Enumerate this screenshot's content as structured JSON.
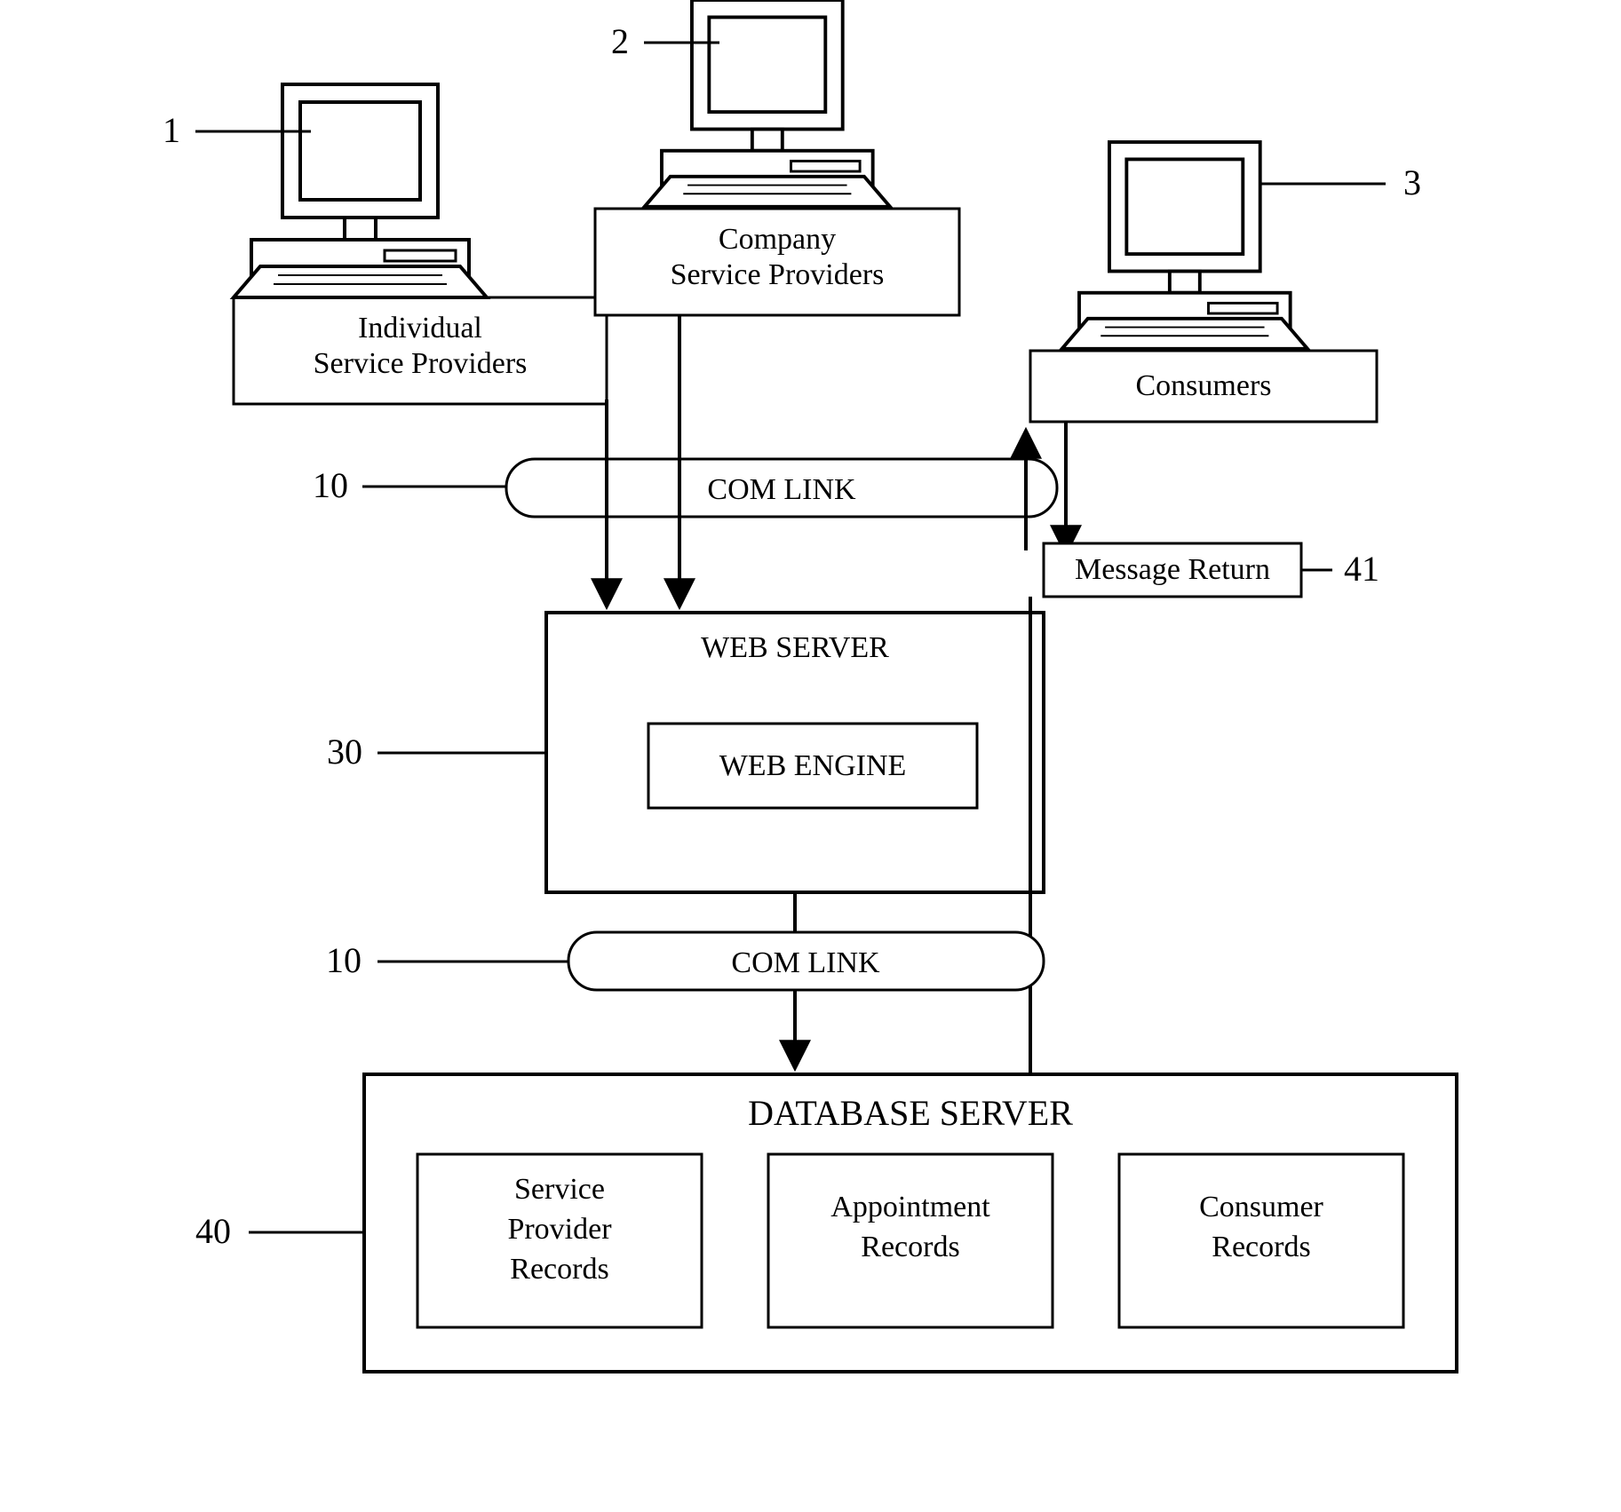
{
  "ref": {
    "n1": "1",
    "n2": "2",
    "n3": "3",
    "n10a": "10",
    "n10b": "10",
    "n30": "30",
    "n40": "40",
    "n41": "41"
  },
  "terminals": {
    "individual_l1": "Individual",
    "individual_l2": "Service Providers",
    "company_l1": "Company",
    "company_l2": "Service Providers",
    "consumers": "Consumers"
  },
  "links": {
    "com_link_top": "COM LINK",
    "com_link_bottom": "COM LINK"
  },
  "webserver": {
    "title": "WEB SERVER",
    "engine": "WEB ENGINE"
  },
  "message_return": "Message Return",
  "dbserver": {
    "title": "DATABASE SERVER",
    "rec1_l1": "Service",
    "rec1_l2": "Provider",
    "rec1_l3": "Records",
    "rec2_l1": "Appointment",
    "rec2_l2": "Records",
    "rec3_l1": "Consumer",
    "rec3_l2": "Records"
  }
}
